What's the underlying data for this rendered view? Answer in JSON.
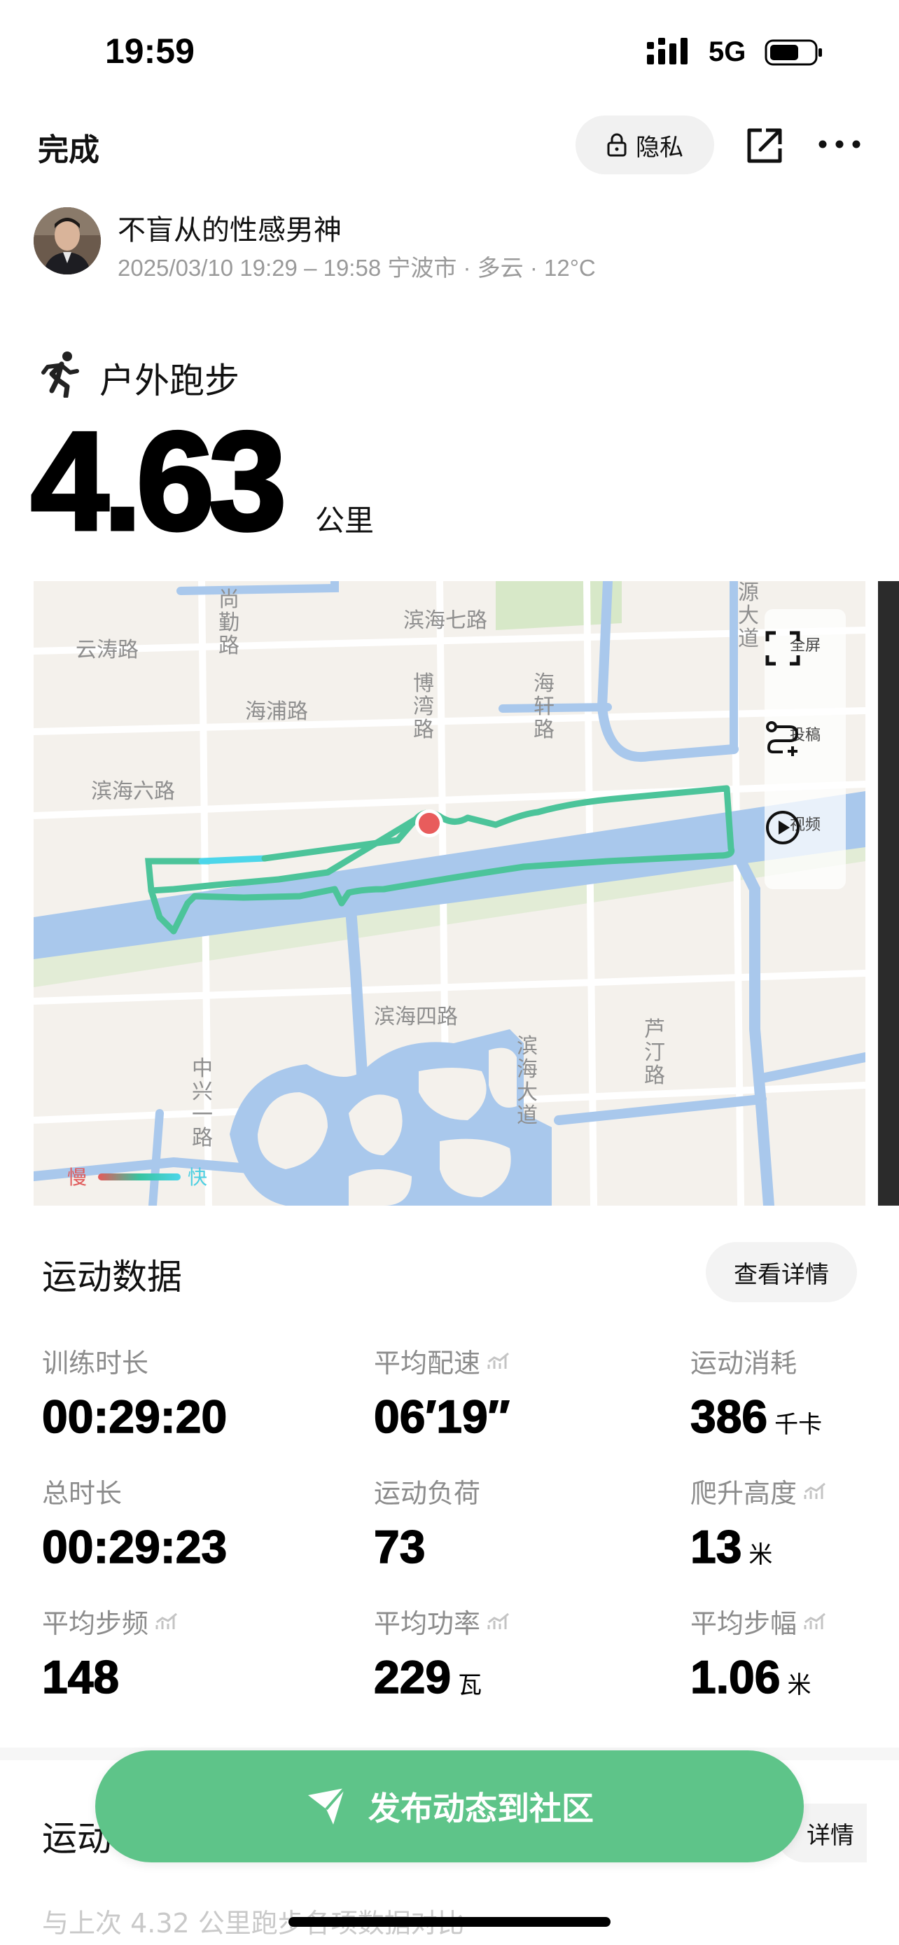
{
  "status_bar": {
    "time": "19:59",
    "network": "5G",
    "icons": [
      "signal-icon",
      "battery-icon"
    ]
  },
  "nav": {
    "done_label": "完成",
    "privacy_label": "隐私",
    "icons": [
      "lock-icon",
      "share-icon",
      "more-icon"
    ]
  },
  "user": {
    "name": "不盲从的性感男神",
    "meta": "2025/03/10 19:29 – 19:58 宁波市 · 多云 · 12°C"
  },
  "workout": {
    "type": "户外跑步",
    "distance": "4.63",
    "distance_unit": "公里",
    "icon": "running-icon"
  },
  "map": {
    "labels": {
      "yuntao_rd": "云涛路",
      "shangqin_rd": "尚勤路",
      "binhai7_rd": "滨海七路",
      "yuan_ave": "源大道",
      "haipu_rd": "海浦路",
      "bowan_rd": "博湾路",
      "haixuan_rd": "海轩路",
      "binhai6_rd": "滨海六路",
      "binhai4_rd": "滨海四路",
      "binhai_ave": "滨海大道",
      "luting_rd": "芦汀路",
      "zhongxing1_rd": "中兴一路"
    },
    "controls": {
      "fullscreen": "全屏",
      "submit": "投稿",
      "video": "视频"
    },
    "legend": {
      "slow": "慢",
      "fast": "快"
    },
    "colors": {
      "route": "#4cc49a",
      "water": "#a9c8ec",
      "land": "#f4f1ec",
      "green": "#e2ecd6",
      "start": "#e85c5c"
    }
  },
  "stats_section": {
    "title": "运动数据",
    "details_label": "查看详情",
    "items": [
      {
        "label": "训练时长",
        "value": "00:29:20",
        "unit": ""
      },
      {
        "label": "平均配速",
        "value": "06′19″",
        "unit": ""
      },
      {
        "label": "运动消耗",
        "value": "386",
        "unit": "千卡"
      },
      {
        "label": "总时长",
        "value": "00:29:23",
        "unit": ""
      },
      {
        "label": "运动负荷",
        "value": "73",
        "unit": ""
      },
      {
        "label": "爬升高度",
        "value": "13",
        "unit": "米"
      },
      {
        "label": "平均步频",
        "value": "148",
        "unit": ""
      },
      {
        "label": "平均功率",
        "value": "229",
        "unit": "瓦"
      },
      {
        "label": "平均步幅",
        "value": "1.06",
        "unit": "米"
      }
    ]
  },
  "section2": {
    "title": "运动",
    "details_label": "详情",
    "compare_text": "与上次 4.32 公里跑步各项数据对比"
  },
  "publish": {
    "label": "发布动态到社区",
    "icon": "send-icon",
    "color": "#5ec489"
  }
}
